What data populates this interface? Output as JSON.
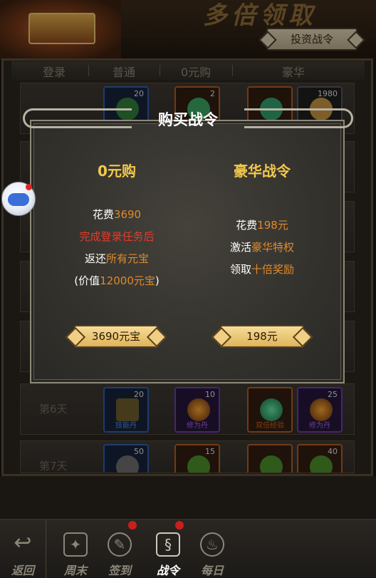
{
  "banner": {
    "title": "多倍领取",
    "invest_button": "投资战令"
  },
  "columns": [
    "登录",
    "普通",
    "0元购",
    "豪华"
  ],
  "rows": [
    {
      "label": "",
      "items": [
        {
          "count": "20",
          "name": "",
          "rarity": "blue"
        },
        {
          "count": "2",
          "name": "",
          "rarity": "orange"
        },
        {
          "count": "",
          "name": "",
          "rarity": "orange"
        },
        {
          "count": "1980",
          "name": "",
          "rarity": "gray"
        }
      ]
    },
    {
      "label": "第6天",
      "items": [
        {
          "count": "20",
          "name": "技能丹",
          "rarity": "blue"
        },
        {
          "count": "10",
          "name": "修为丹",
          "rarity": "purple"
        },
        {
          "count": "",
          "name": "双倍经验",
          "rarity": "orange"
        },
        {
          "count": "25",
          "name": "修为丹",
          "rarity": "purple"
        }
      ]
    },
    {
      "label": "第7天",
      "items": [
        {
          "count": "50",
          "name": "",
          "rarity": "blue"
        },
        {
          "count": "15",
          "name": "",
          "rarity": "orange"
        },
        {
          "count": "",
          "name": "",
          "rarity": "orange"
        },
        {
          "count": "40",
          "name": "",
          "rarity": "orange"
        }
      ]
    }
  ],
  "dialog": {
    "title": "购买战令",
    "left": {
      "title": "0元购",
      "line1_a": "花费",
      "line1_b": "3690",
      "line2": "完成登录任务后",
      "line3_a": "返还",
      "line3_b": "所有元宝",
      "line4_a": "(价值",
      "line4_b": "12000元宝",
      "line4_c": ")",
      "button": "3690元宝"
    },
    "right": {
      "title": "豪华战令",
      "line1_a": "花费",
      "line1_b": "198元",
      "line2_a": "激活",
      "line2_b": "豪华特权",
      "line3_a": "领取",
      "line3_b": "十倍奖励",
      "button": "198元"
    }
  },
  "nav": {
    "back": "返回",
    "weekend": "周末",
    "checkin": "签到",
    "battlepass": "战令",
    "daily": "每日"
  },
  "colors": {
    "gold_title": "#f2c94c",
    "highlight": "#e08a2a",
    "red_text": "#e83a2a",
    "button_gold": "#e0b45a"
  }
}
